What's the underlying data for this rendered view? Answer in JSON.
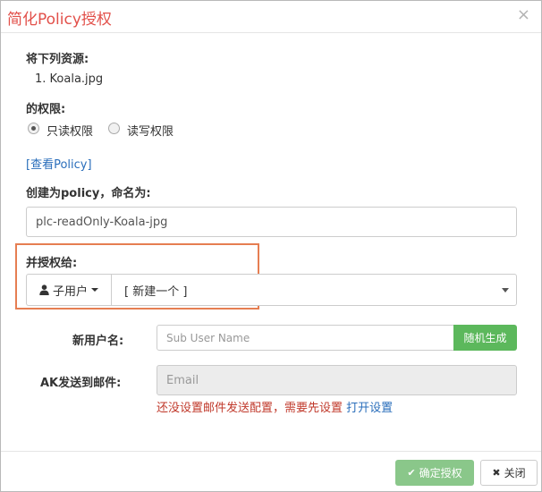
{
  "dialog": {
    "title": "简化Policy授权",
    "close_symbol": "×"
  },
  "resources": {
    "label": "将下列资源:",
    "items": [
      "1. Koala.jpg"
    ]
  },
  "permission": {
    "label": "的权限:",
    "options": [
      {
        "label": "只读权限",
        "checked": true
      },
      {
        "label": "读写权限",
        "checked": false
      }
    ]
  },
  "view_policy_link": "[查看Policy]",
  "policy_name": {
    "label": "创建为policy，命名为:",
    "value": "plc-readOnly-Koala-jpg"
  },
  "grant": {
    "label": "并授权给:",
    "type_dropdown_label": "子用户",
    "target_select_value": "[ 新建一个 ]"
  },
  "new_user": {
    "label": "新用户名:",
    "placeholder": "Sub User Name",
    "random_button": "随机生成"
  },
  "ak_email": {
    "label": "AK发送到邮件:",
    "placeholder": "Email",
    "warning_text": "还没设置邮件发送配置，需要先设置",
    "warning_link": "打开设置"
  },
  "footer": {
    "ok_label": "确定授权",
    "close_label": "关闭"
  },
  "colors": {
    "title": "#e2504a",
    "link": "#2a6ebb",
    "success": "#5cb85c",
    "warning": "#c0392b",
    "highlight": "#e67e52"
  }
}
